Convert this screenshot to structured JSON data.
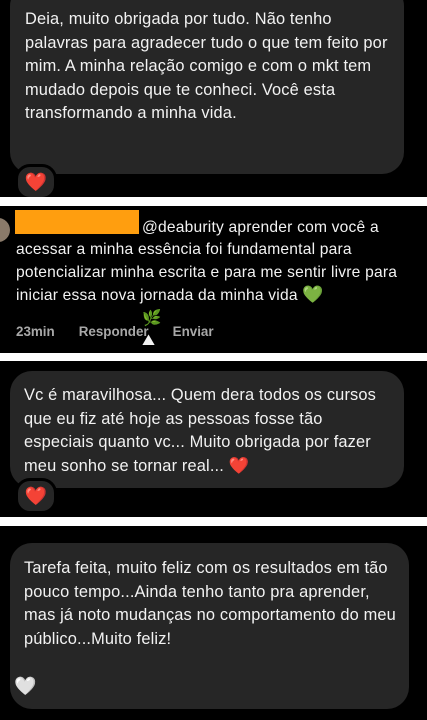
{
  "messages": [
    {
      "text": "Deia, muito obrigada por tudo. Não tenho palavras para agradecer tudo o que tem feito por mim. A minha relação comigo e com o mkt tem mudado depois que te conheci. Você esta transformando a minha vida.",
      "reaction": "❤️"
    },
    {
      "text": "Vc é maravilhosa... Quem dera todos os cursos que eu fiz até hoje as pessoas fosse tão especiais quanto vc... Muito obrigada por fazer meu sonho se tornar real...",
      "inline_emoji": "❤️",
      "reaction": "❤️"
    },
    {
      "text": "Tarefa feita, muito feliz com os resultados em tão pouco tempo...Ainda tenho tanto pra aprender, mas já noto mudanças no comportamento do meu público...Muito feliz!",
      "inline_emoji": "🤍"
    }
  ],
  "comment": {
    "mention": "@deaburity",
    "text": "aprender com você a acessar a minha essência foi fundamental para potencializar minha escrita e para me sentir livre para iniciar essa nova jornada da minha vida",
    "emojis": [
      "💚",
      "🌿",
      "⛰"
    ],
    "time": "23min",
    "reply_label": "Responder",
    "send_label": "Enviar"
  },
  "colors": {
    "background": "#000000",
    "bubble": "#262626",
    "text": "#f2f2f2",
    "meta_text": "#a8a8a8",
    "redaction": "#ff9e0f",
    "heart": "#ff3040"
  }
}
